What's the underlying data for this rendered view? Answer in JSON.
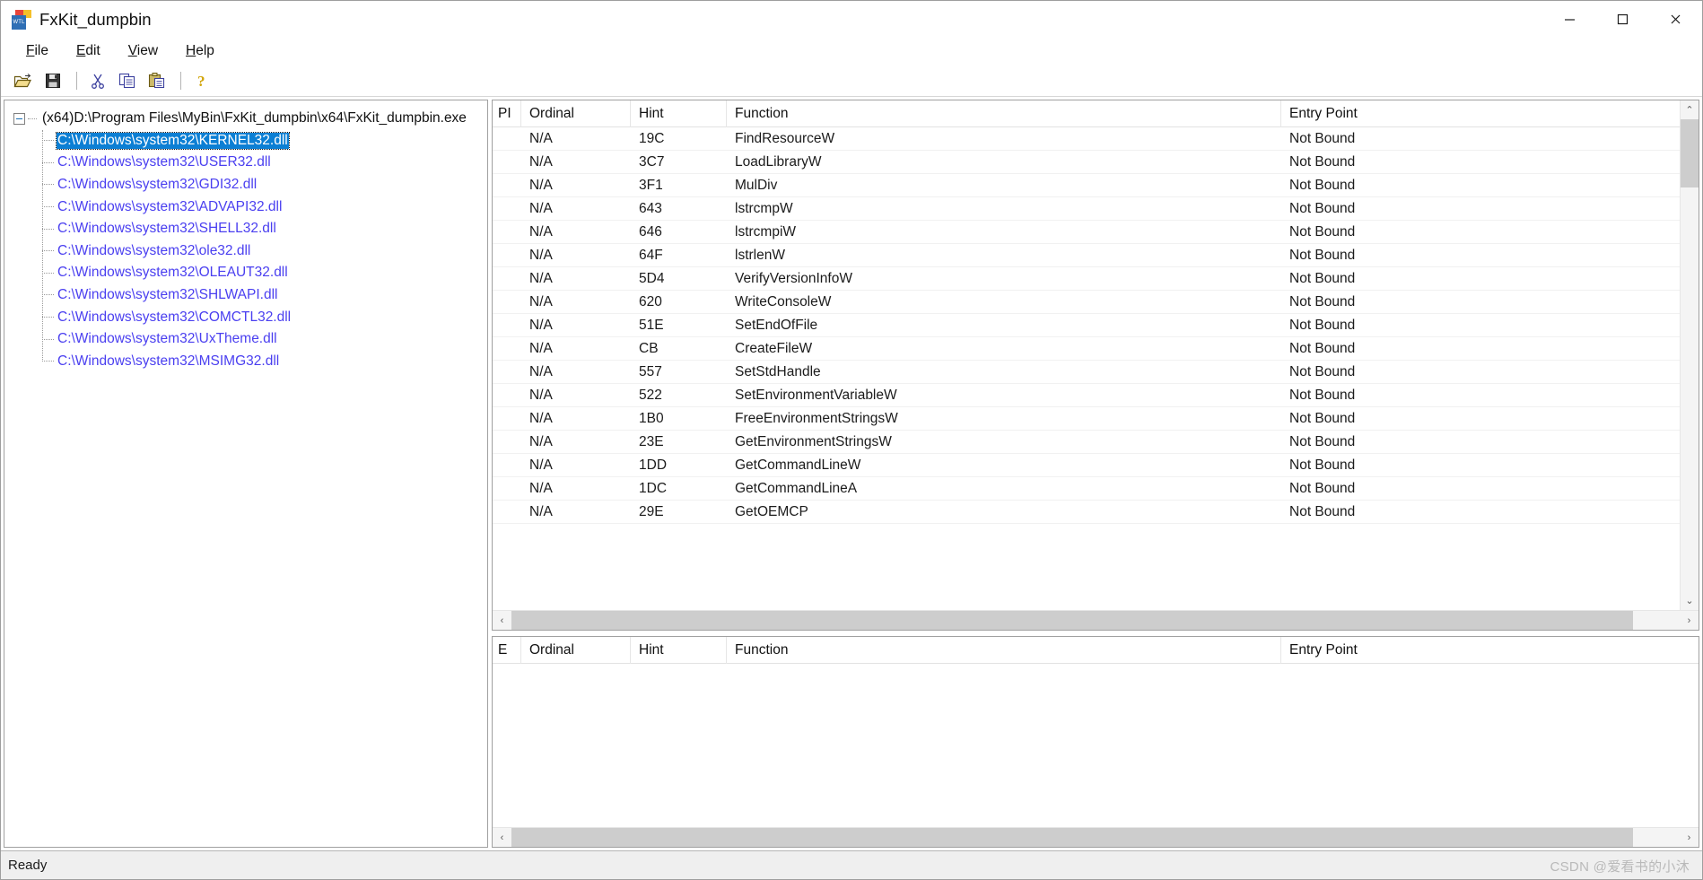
{
  "window": {
    "title": "FxKit_dumpbin",
    "icon_name": "wtl-app-icon",
    "icon_label": "WTL",
    "controls": {
      "minimize": "—",
      "maximize": "□",
      "close": "✕"
    }
  },
  "menubar": {
    "items": [
      {
        "label": "File",
        "mnemonic": "F"
      },
      {
        "label": "Edit",
        "mnemonic": "E"
      },
      {
        "label": "View",
        "mnemonic": "V"
      },
      {
        "label": "Help",
        "mnemonic": "H"
      }
    ]
  },
  "toolbar": {
    "buttons": [
      {
        "name": "open-icon",
        "tooltip": "Open"
      },
      {
        "name": "save-icon",
        "tooltip": "Save"
      },
      {
        "name": "cut-icon",
        "tooltip": "Cut"
      },
      {
        "name": "copy-icon",
        "tooltip": "Copy"
      },
      {
        "name": "paste-icon",
        "tooltip": "Paste"
      },
      {
        "name": "help-icon",
        "tooltip": "About"
      }
    ]
  },
  "tree": {
    "root": {
      "label": "(x64)D:\\Program Files\\MyBin\\FxKit_dumpbin\\x64\\FxKit_dumpbin.exe",
      "expanded": true
    },
    "children": [
      {
        "label": "C:\\Windows\\system32\\KERNEL32.dll",
        "selected": true
      },
      {
        "label": "C:\\Windows\\system32\\USER32.dll",
        "selected": false
      },
      {
        "label": "C:\\Windows\\system32\\GDI32.dll",
        "selected": false
      },
      {
        "label": "C:\\Windows\\system32\\ADVAPI32.dll",
        "selected": false
      },
      {
        "label": "C:\\Windows\\system32\\SHELL32.dll",
        "selected": false
      },
      {
        "label": "C:\\Windows\\system32\\ole32.dll",
        "selected": false
      },
      {
        "label": "C:\\Windows\\system32\\OLEAUT32.dll",
        "selected": false
      },
      {
        "label": "C:\\Windows\\system32\\SHLWAPI.dll",
        "selected": false
      },
      {
        "label": "C:\\Windows\\system32\\COMCTL32.dll",
        "selected": false
      },
      {
        "label": "C:\\Windows\\system32\\UxTheme.dll",
        "selected": false
      },
      {
        "label": "C:\\Windows\\system32\\MSIMG32.dll",
        "selected": false
      }
    ],
    "colors": {
      "link": "#4a3ff0",
      "selection_bg": "#0c7fd4",
      "selection_fg": "#ffffff"
    }
  },
  "imports_panel": {
    "columns": [
      "PI",
      "Ordinal",
      "Hint",
      "Function",
      "Entry Point"
    ],
    "rows": [
      {
        "pi": "",
        "ordinal": "N/A",
        "hint": "19C",
        "function": "FindResourceW",
        "entry_point": "Not Bound"
      },
      {
        "pi": "",
        "ordinal": "N/A",
        "hint": "3C7",
        "function": "LoadLibraryW",
        "entry_point": "Not Bound"
      },
      {
        "pi": "",
        "ordinal": "N/A",
        "hint": "3F1",
        "function": "MulDiv",
        "entry_point": "Not Bound"
      },
      {
        "pi": "",
        "ordinal": "N/A",
        "hint": "643",
        "function": "lstrcmpW",
        "entry_point": "Not Bound"
      },
      {
        "pi": "",
        "ordinal": "N/A",
        "hint": "646",
        "function": "lstrcmpiW",
        "entry_point": "Not Bound"
      },
      {
        "pi": "",
        "ordinal": "N/A",
        "hint": "64F",
        "function": "lstrlenW",
        "entry_point": "Not Bound"
      },
      {
        "pi": "",
        "ordinal": "N/A",
        "hint": "5D4",
        "function": "VerifyVersionInfoW",
        "entry_point": "Not Bound"
      },
      {
        "pi": "",
        "ordinal": "N/A",
        "hint": "620",
        "function": "WriteConsoleW",
        "entry_point": "Not Bound"
      },
      {
        "pi": "",
        "ordinal": "N/A",
        "hint": "51E",
        "function": "SetEndOfFile",
        "entry_point": "Not Bound"
      },
      {
        "pi": "",
        "ordinal": "N/A",
        "hint": "CB",
        "function": "CreateFileW",
        "entry_point": "Not Bound"
      },
      {
        "pi": "",
        "ordinal": "N/A",
        "hint": "557",
        "function": "SetStdHandle",
        "entry_point": "Not Bound"
      },
      {
        "pi": "",
        "ordinal": "N/A",
        "hint": "522",
        "function": "SetEnvironmentVariableW",
        "entry_point": "Not Bound"
      },
      {
        "pi": "",
        "ordinal": "N/A",
        "hint": "1B0",
        "function": "FreeEnvironmentStringsW",
        "entry_point": "Not Bound"
      },
      {
        "pi": "",
        "ordinal": "N/A",
        "hint": "23E",
        "function": "GetEnvironmentStringsW",
        "entry_point": "Not Bound"
      },
      {
        "pi": "",
        "ordinal": "N/A",
        "hint": "1DD",
        "function": "GetCommandLineW",
        "entry_point": "Not Bound"
      },
      {
        "pi": "",
        "ordinal": "N/A",
        "hint": "1DC",
        "function": "GetCommandLineA",
        "entry_point": "Not Bound"
      },
      {
        "pi": "",
        "ordinal": "N/A",
        "hint": "29E",
        "function": "GetOEMCP",
        "entry_point": "Not Bound"
      }
    ],
    "scroll": {
      "vertical_up": "⌃",
      "vertical_down": "⌄",
      "horizontal_left": "‹",
      "horizontal_right": "›"
    }
  },
  "exports_panel": {
    "columns": [
      "E",
      "Ordinal",
      "Hint",
      "Function",
      "Entry Point"
    ],
    "rows": [],
    "scroll": {
      "horizontal_left": "‹",
      "horizontal_right": "›"
    }
  },
  "statusbar": {
    "text": "Ready",
    "watermark": "CSDN @爱看书的小沐"
  }
}
